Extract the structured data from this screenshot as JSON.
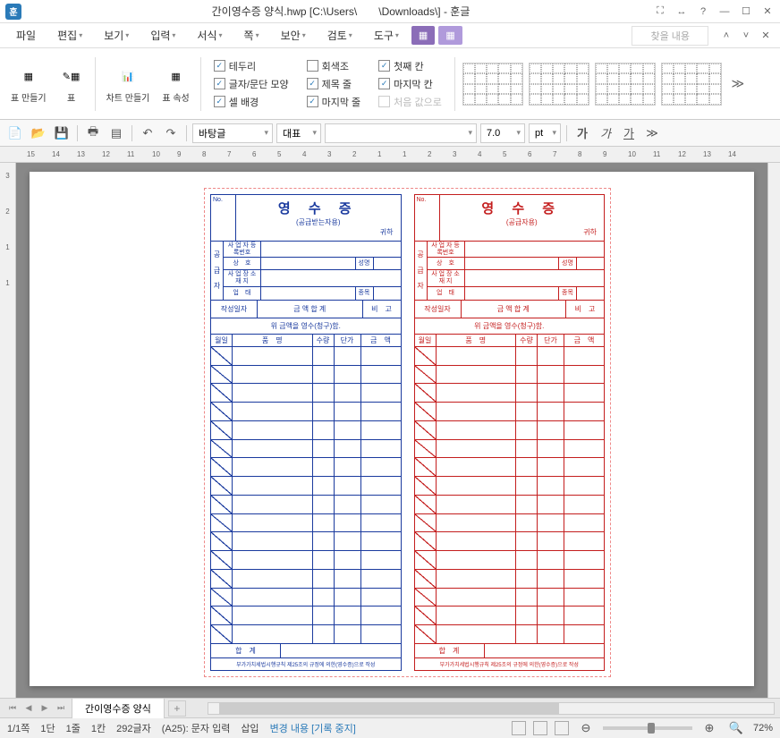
{
  "title": "간이영수증 양식.hwp [C:\\Users\\　　\\Downloads\\] - 훈글",
  "app_icon": "훈",
  "menus": [
    "파일",
    "편집",
    "보기",
    "입력",
    "서식",
    "쪽",
    "보안",
    "검토",
    "도구"
  ],
  "menu_search_placeholder": "찾을 내용",
  "ribbon": {
    "g1": [
      {
        "label": "표\n만들기"
      },
      {
        "label": "표"
      }
    ],
    "g2": [
      {
        "label": "차트\n만들기"
      },
      {
        "label": "표\n속성"
      }
    ],
    "checks1": [
      "테두리",
      "글자/문단 모양",
      "셀 배경"
    ],
    "checks2": [
      "회색조",
      "제목 줄",
      "마지막 줄"
    ],
    "checks3": [
      "첫째 칸",
      "마지막 칸",
      "처음 값으로"
    ]
  },
  "toolbar": {
    "style": "바탕글",
    "rep": "대표",
    "font": "",
    "size": "7.0",
    "unit": "pt"
  },
  "ruler_h": [
    "15",
    "14",
    "13",
    "12",
    "11",
    "10",
    "9",
    "8",
    "7",
    "6",
    "5",
    "4",
    "3",
    "2",
    "1",
    "1",
    "2",
    "3",
    "4",
    "5",
    "6",
    "7",
    "8",
    "9",
    "10",
    "11",
    "12",
    "13",
    "14"
  ],
  "ruler_v": [
    "3",
    "2",
    "1",
    "1"
  ],
  "receipt": {
    "no": "No.",
    "title_main": "영 수 증",
    "title_sub_blue": "(공급받는자용)",
    "title_sub_red": "(공급자용)",
    "title_sub2": "귀하",
    "supplier_label": [
      "공",
      "급",
      "자"
    ],
    "rows": [
      [
        "사 업 자\n등록번호",
        ""
      ],
      [
        "상　호",
        "",
        "성명",
        ""
      ],
      [
        "사 업 장\n소 재 지",
        ""
      ],
      [
        "업　태",
        "",
        "종목",
        ""
      ]
    ],
    "summary": [
      "작성일자",
      "금 액 합 계",
      "비　고"
    ],
    "note_blue": "위 금액을 영수(청구)함.",
    "note_red": "위 금액을 영수(청구)함.",
    "thead": [
      "월일",
      "품　명",
      "수량",
      "단가",
      "금　액"
    ],
    "total": "합　계",
    "foot": "부가가치세법시행규칙 제25조의 규정에 의한(영수증)으로 작성"
  },
  "tabs": {
    "doc": "간이영수증 양식"
  },
  "status": {
    "page": "1/1쪽",
    "dan": "1단",
    "line": "1줄",
    "col": "1칸",
    "chars": "292글자",
    "cell": "(A25): 문자 입력",
    "mode": "삽입",
    "change": "변경 내용 [기록 중지]",
    "zoom": "72%"
  }
}
